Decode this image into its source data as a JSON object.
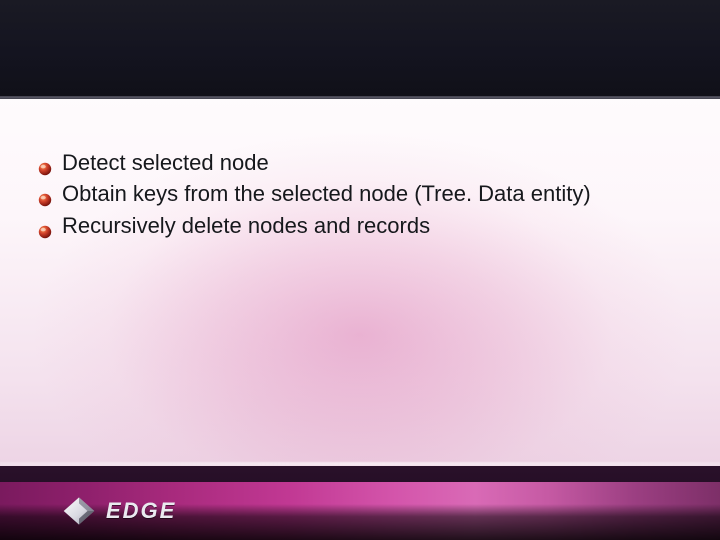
{
  "bullets": [
    "Detect selected node",
    "Obtain keys from the selected node (Tree. Data entity)",
    "Recursively delete nodes and records"
  ],
  "logo": {
    "text": "EDGE"
  },
  "colors": {
    "bullet_gradient_top": "#d0402a",
    "bullet_gradient_bottom": "#7a0f0a",
    "text": "#16181c"
  }
}
